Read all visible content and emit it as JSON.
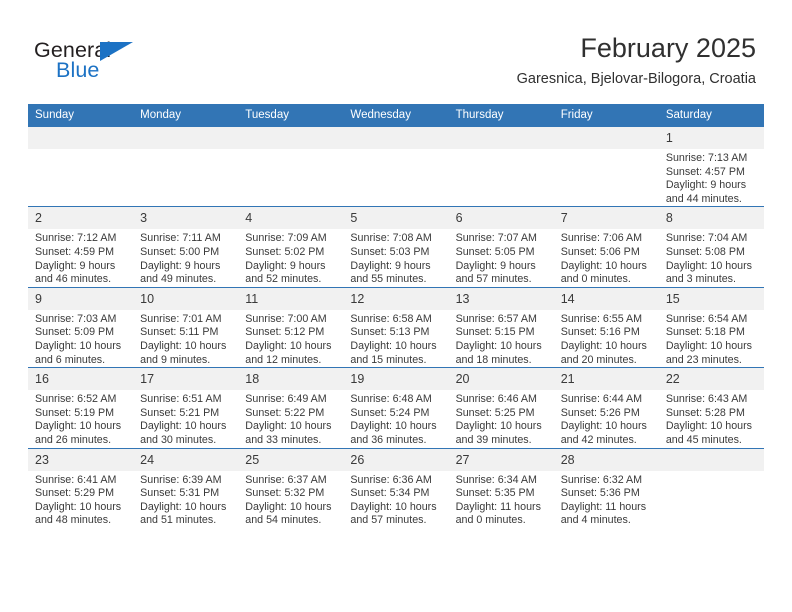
{
  "brand": {
    "word_one": "General",
    "word_two": "Blue",
    "accent_color": "#1c72c4",
    "triangle_icon": "triangle-icon"
  },
  "header": {
    "title": "February 2025",
    "subtitle": "Garesnica, Bjelovar-Bilogora, Croatia"
  },
  "theme": {
    "header_blue": "#3275b5",
    "daynum_band": "#f1f1f1",
    "text": "#3a3a3a"
  },
  "weekdays": [
    "Sunday",
    "Monday",
    "Tuesday",
    "Wednesday",
    "Thursday",
    "Friday",
    "Saturday"
  ],
  "labels": {
    "sunrise": "Sunrise:",
    "sunset": "Sunset:",
    "daylight": "Daylight:"
  },
  "weeks": [
    [
      {
        "blank": true
      },
      {
        "blank": true
      },
      {
        "blank": true
      },
      {
        "blank": true
      },
      {
        "blank": true
      },
      {
        "blank": true
      },
      {
        "day": "1",
        "sunrise": "Sunrise: 7:13 AM",
        "sunset": "Sunset: 4:57 PM",
        "daylight_1": "Daylight: 9 hours",
        "daylight_2": "and 44 minutes."
      }
    ],
    [
      {
        "day": "2",
        "sunrise": "Sunrise: 7:12 AM",
        "sunset": "Sunset: 4:59 PM",
        "daylight_1": "Daylight: 9 hours",
        "daylight_2": "and 46 minutes."
      },
      {
        "day": "3",
        "sunrise": "Sunrise: 7:11 AM",
        "sunset": "Sunset: 5:00 PM",
        "daylight_1": "Daylight: 9 hours",
        "daylight_2": "and 49 minutes."
      },
      {
        "day": "4",
        "sunrise": "Sunrise: 7:09 AM",
        "sunset": "Sunset: 5:02 PM",
        "daylight_1": "Daylight: 9 hours",
        "daylight_2": "and 52 minutes."
      },
      {
        "day": "5",
        "sunrise": "Sunrise: 7:08 AM",
        "sunset": "Sunset: 5:03 PM",
        "daylight_1": "Daylight: 9 hours",
        "daylight_2": "and 55 minutes."
      },
      {
        "day": "6",
        "sunrise": "Sunrise: 7:07 AM",
        "sunset": "Sunset: 5:05 PM",
        "daylight_1": "Daylight: 9 hours",
        "daylight_2": "and 57 minutes."
      },
      {
        "day": "7",
        "sunrise": "Sunrise: 7:06 AM",
        "sunset": "Sunset: 5:06 PM",
        "daylight_1": "Daylight: 10 hours",
        "daylight_2": "and 0 minutes."
      },
      {
        "day": "8",
        "sunrise": "Sunrise: 7:04 AM",
        "sunset": "Sunset: 5:08 PM",
        "daylight_1": "Daylight: 10 hours",
        "daylight_2": "and 3 minutes."
      }
    ],
    [
      {
        "day": "9",
        "sunrise": "Sunrise: 7:03 AM",
        "sunset": "Sunset: 5:09 PM",
        "daylight_1": "Daylight: 10 hours",
        "daylight_2": "and 6 minutes."
      },
      {
        "day": "10",
        "sunrise": "Sunrise: 7:01 AM",
        "sunset": "Sunset: 5:11 PM",
        "daylight_1": "Daylight: 10 hours",
        "daylight_2": "and 9 minutes."
      },
      {
        "day": "11",
        "sunrise": "Sunrise: 7:00 AM",
        "sunset": "Sunset: 5:12 PM",
        "daylight_1": "Daylight: 10 hours",
        "daylight_2": "and 12 minutes."
      },
      {
        "day": "12",
        "sunrise": "Sunrise: 6:58 AM",
        "sunset": "Sunset: 5:13 PM",
        "daylight_1": "Daylight: 10 hours",
        "daylight_2": "and 15 minutes."
      },
      {
        "day": "13",
        "sunrise": "Sunrise: 6:57 AM",
        "sunset": "Sunset: 5:15 PM",
        "daylight_1": "Daylight: 10 hours",
        "daylight_2": "and 18 minutes."
      },
      {
        "day": "14",
        "sunrise": "Sunrise: 6:55 AM",
        "sunset": "Sunset: 5:16 PM",
        "daylight_1": "Daylight: 10 hours",
        "daylight_2": "and 20 minutes."
      },
      {
        "day": "15",
        "sunrise": "Sunrise: 6:54 AM",
        "sunset": "Sunset: 5:18 PM",
        "daylight_1": "Daylight: 10 hours",
        "daylight_2": "and 23 minutes."
      }
    ],
    [
      {
        "day": "16",
        "sunrise": "Sunrise: 6:52 AM",
        "sunset": "Sunset: 5:19 PM",
        "daylight_1": "Daylight: 10 hours",
        "daylight_2": "and 26 minutes."
      },
      {
        "day": "17",
        "sunrise": "Sunrise: 6:51 AM",
        "sunset": "Sunset: 5:21 PM",
        "daylight_1": "Daylight: 10 hours",
        "daylight_2": "and 30 minutes."
      },
      {
        "day": "18",
        "sunrise": "Sunrise: 6:49 AM",
        "sunset": "Sunset: 5:22 PM",
        "daylight_1": "Daylight: 10 hours",
        "daylight_2": "and 33 minutes."
      },
      {
        "day": "19",
        "sunrise": "Sunrise: 6:48 AM",
        "sunset": "Sunset: 5:24 PM",
        "daylight_1": "Daylight: 10 hours",
        "daylight_2": "and 36 minutes."
      },
      {
        "day": "20",
        "sunrise": "Sunrise: 6:46 AM",
        "sunset": "Sunset: 5:25 PM",
        "daylight_1": "Daylight: 10 hours",
        "daylight_2": "and 39 minutes."
      },
      {
        "day": "21",
        "sunrise": "Sunrise: 6:44 AM",
        "sunset": "Sunset: 5:26 PM",
        "daylight_1": "Daylight: 10 hours",
        "daylight_2": "and 42 minutes."
      },
      {
        "day": "22",
        "sunrise": "Sunrise: 6:43 AM",
        "sunset": "Sunset: 5:28 PM",
        "daylight_1": "Daylight: 10 hours",
        "daylight_2": "and 45 minutes."
      }
    ],
    [
      {
        "day": "23",
        "sunrise": "Sunrise: 6:41 AM",
        "sunset": "Sunset: 5:29 PM",
        "daylight_1": "Daylight: 10 hours",
        "daylight_2": "and 48 minutes."
      },
      {
        "day": "24",
        "sunrise": "Sunrise: 6:39 AM",
        "sunset": "Sunset: 5:31 PM",
        "daylight_1": "Daylight: 10 hours",
        "daylight_2": "and 51 minutes."
      },
      {
        "day": "25",
        "sunrise": "Sunrise: 6:37 AM",
        "sunset": "Sunset: 5:32 PM",
        "daylight_1": "Daylight: 10 hours",
        "daylight_2": "and 54 minutes."
      },
      {
        "day": "26",
        "sunrise": "Sunrise: 6:36 AM",
        "sunset": "Sunset: 5:34 PM",
        "daylight_1": "Daylight: 10 hours",
        "daylight_2": "and 57 minutes."
      },
      {
        "day": "27",
        "sunrise": "Sunrise: 6:34 AM",
        "sunset": "Sunset: 5:35 PM",
        "daylight_1": "Daylight: 11 hours",
        "daylight_2": "and 0 minutes."
      },
      {
        "day": "28",
        "sunrise": "Sunrise: 6:32 AM",
        "sunset": "Sunset: 5:36 PM",
        "daylight_1": "Daylight: 11 hours",
        "daylight_2": "and 4 minutes."
      },
      {
        "blank": true
      }
    ]
  ]
}
